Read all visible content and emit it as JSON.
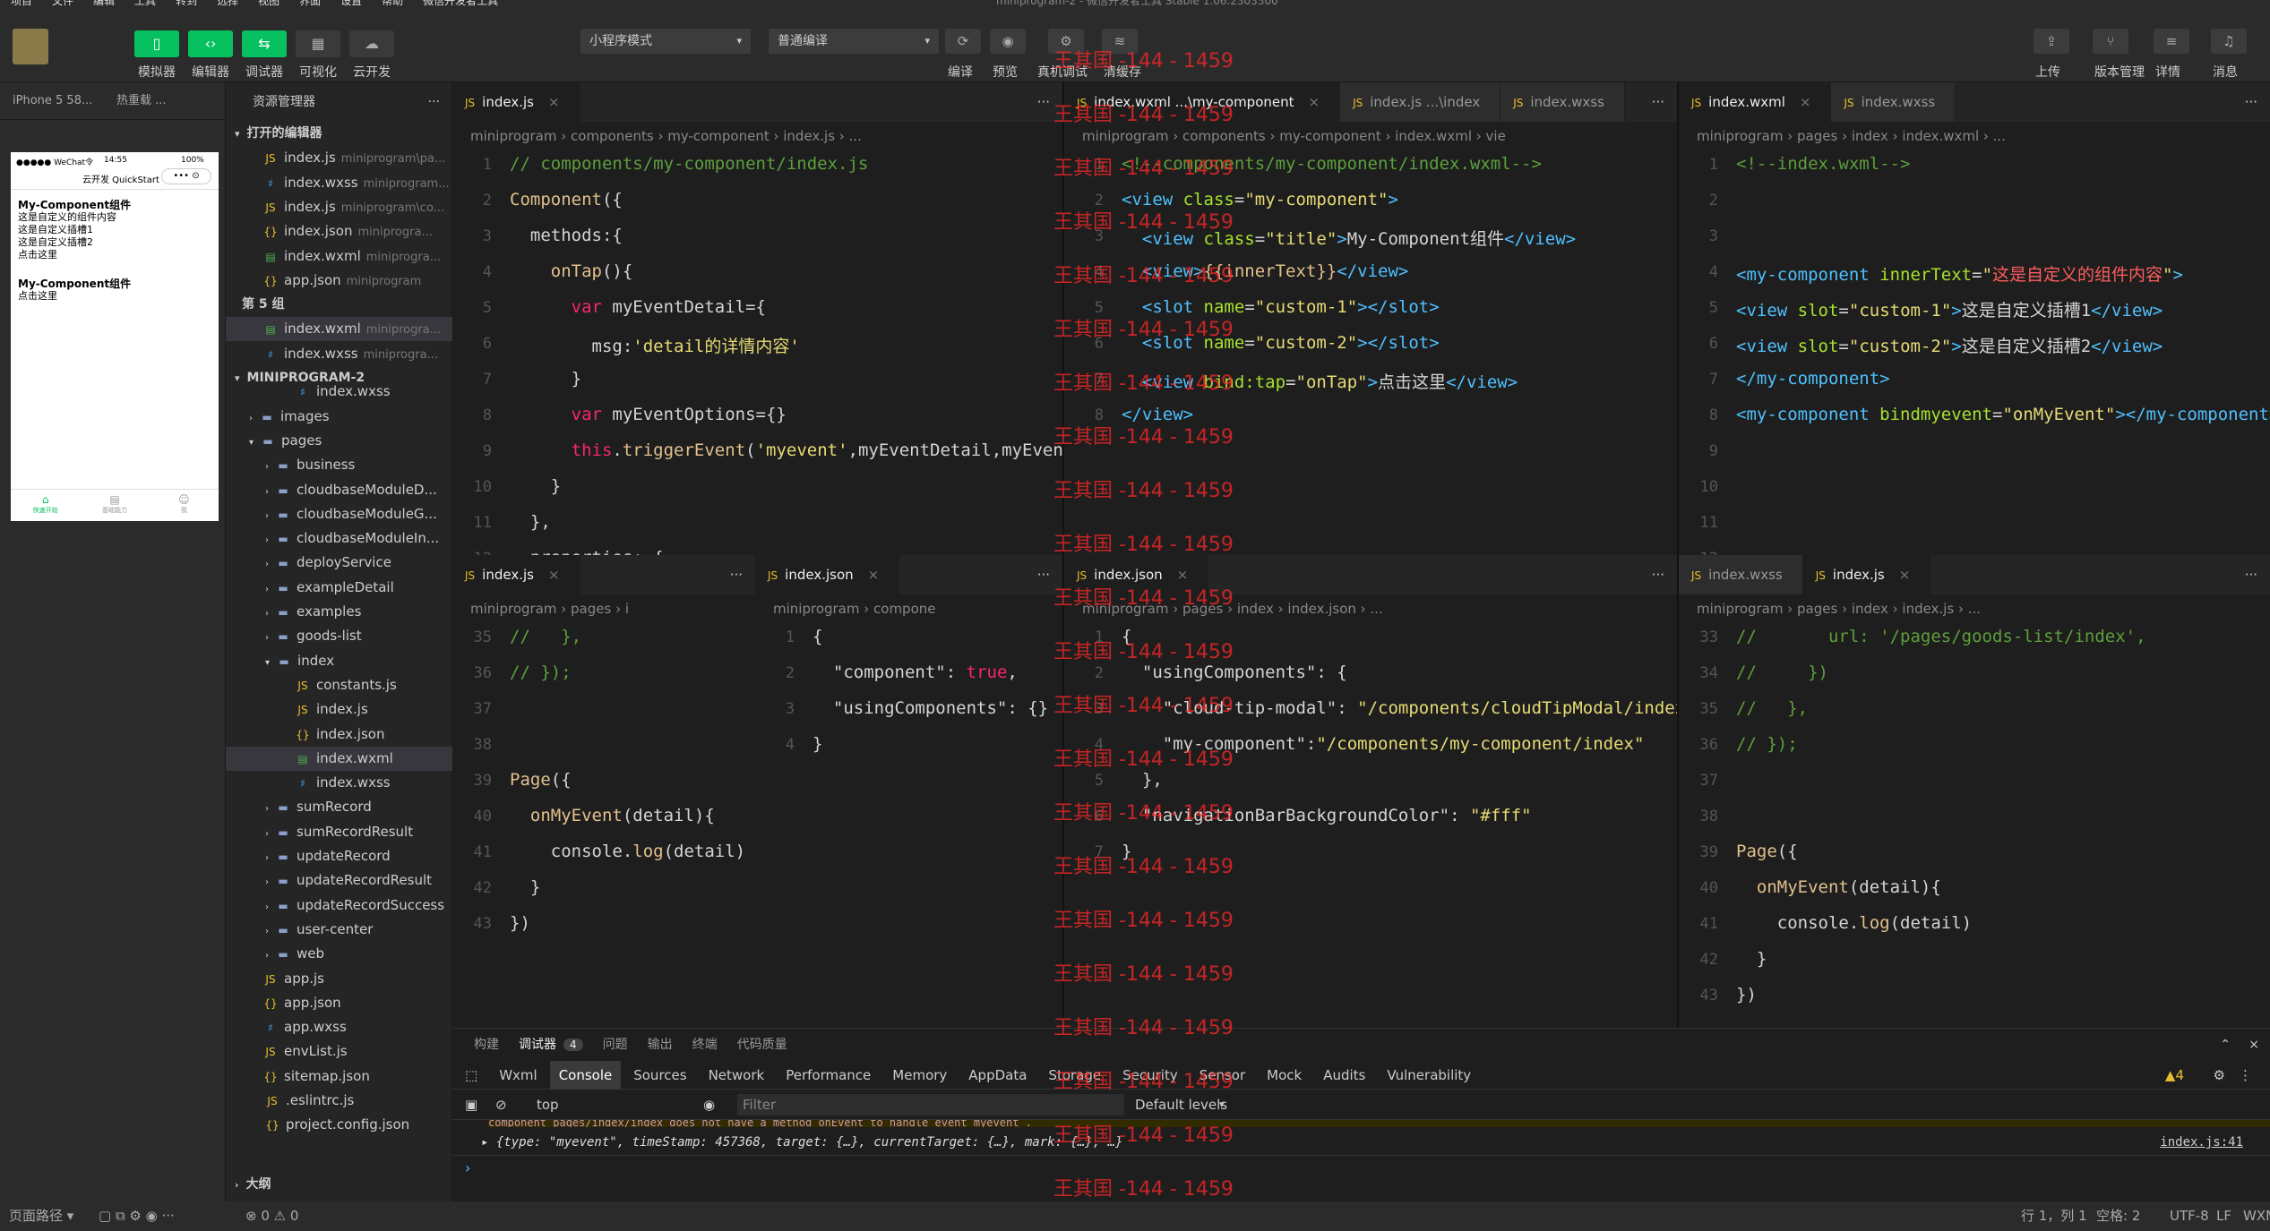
{
  "menubar": {
    "items": [
      "项目",
      "文件",
      "编辑",
      "工具",
      "转到",
      "选择",
      "视图",
      "界面",
      "设置",
      "帮助",
      "微信开发者工具"
    ],
    "window_title": "miniprogram-2 - 微信开发者工具 Stable 1.06.2303300"
  },
  "toolbar": {
    "buttons": [
      {
        "label": "模拟器",
        "icon": "phone-icon"
      },
      {
        "label": "编辑器",
        "icon": "code-icon"
      },
      {
        "label": "调试器",
        "icon": "debug-icon"
      },
      {
        "label": "可视化",
        "icon": "layout-icon"
      },
      {
        "label": "云开发",
        "icon": "cloud-icon"
      }
    ],
    "mode_select": "小程序模式",
    "compile_select": "普通编译",
    "actions": [
      "编译",
      "预览",
      "真机调试",
      "清缓存"
    ],
    "right": [
      "上传",
      "版本管理",
      "详情",
      "消息"
    ]
  },
  "simulator": {
    "device": "iPhone 5 58...",
    "reload": "热重载 ...",
    "wechat_status": "●●●●● WeChat令",
    "time": "14:55",
    "battery": "100%",
    "nav_title": "云开发 QuickStart",
    "lines": [
      "My-Component组件",
      "这是自定义的组件内容",
      "这是自定义插槽1",
      "这是自定义插槽2",
      "点击这里",
      "",
      "My-Component组件",
      "点击这里"
    ],
    "tabbar": [
      "快速开始",
      "基础能力",
      "我"
    ]
  },
  "explorer": {
    "title": "资源管理器",
    "open_editors": "打开的编辑器",
    "group5": "第 5 组",
    "project": "MINIPROGRAM-2",
    "outline": "大纲",
    "open": [
      {
        "name": "index.js",
        "sub": "miniprogram\\pa...",
        "t": "js"
      },
      {
        "name": "index.wxss",
        "sub": "miniprogram...",
        "t": "wxss"
      },
      {
        "name": "index.js",
        "sub": "miniprogram\\co...",
        "t": "js"
      },
      {
        "name": "index.json",
        "sub": "miniprogra...",
        "t": "json"
      },
      {
        "name": "index.wxml",
        "sub": "miniprogra...",
        "t": "wx"
      },
      {
        "name": "app.json",
        "sub": "miniprogram",
        "t": "json"
      }
    ],
    "group5_files": [
      {
        "name": "index.wxml",
        "sub": "miniprogra...",
        "t": "wx"
      },
      {
        "name": "index.wxss",
        "sub": "miniprogra...",
        "t": "wxss"
      }
    ],
    "tree": [
      {
        "name": "index.wxss",
        "t": "wxss",
        "d": 3
      },
      {
        "name": "images",
        "t": "folder",
        "d": 1
      },
      {
        "name": "pages",
        "t": "folder",
        "d": 1,
        "open": true
      },
      {
        "name": "business",
        "t": "folder",
        "d": 2
      },
      {
        "name": "cloudbaseModuleD...",
        "t": "folder",
        "d": 2
      },
      {
        "name": "cloudbaseModuleG...",
        "t": "folder",
        "d": 2
      },
      {
        "name": "cloudbaseModuleIn...",
        "t": "folder",
        "d": 2
      },
      {
        "name": "deployService",
        "t": "folder",
        "d": 2
      },
      {
        "name": "exampleDetail",
        "t": "folder",
        "d": 2
      },
      {
        "name": "examples",
        "t": "folder",
        "d": 2
      },
      {
        "name": "goods-list",
        "t": "folder",
        "d": 2
      },
      {
        "name": "index",
        "t": "folder",
        "d": 2,
        "open": true
      },
      {
        "name": "constants.js",
        "t": "js",
        "d": 3
      },
      {
        "name": "index.js",
        "t": "js",
        "d": 3
      },
      {
        "name": "index.json",
        "t": "json",
        "d": 3
      },
      {
        "name": "index.wxml",
        "t": "wx",
        "d": 3,
        "sel": true
      },
      {
        "name": "index.wxss",
        "t": "wxss",
        "d": 3
      },
      {
        "name": "sumRecord",
        "t": "folder",
        "d": 2
      },
      {
        "name": "sumRecordResult",
        "t": "folder",
        "d": 2
      },
      {
        "name": "updateRecord",
        "t": "folder",
        "d": 2
      },
      {
        "name": "updateRecordResult",
        "t": "folder",
        "d": 2
      },
      {
        "name": "updateRecordSuccess",
        "t": "folder",
        "d": 2
      },
      {
        "name": "user-center",
        "t": "folder",
        "d": 2
      },
      {
        "name": "web",
        "t": "folder",
        "d": 2
      },
      {
        "name": "app.js",
        "t": "js",
        "d": 1
      },
      {
        "name": "app.json",
        "t": "json",
        "d": 1
      },
      {
        "name": "app.wxss",
        "t": "wxss",
        "d": 1
      },
      {
        "name": "envList.js",
        "t": "js",
        "d": 1
      },
      {
        "name": "sitemap.json",
        "t": "json",
        "d": 1
      },
      {
        "name": ".eslintrc.js",
        "t": "js",
        "d": 0
      },
      {
        "name": "project.config.json",
        "t": "json",
        "d": 0
      }
    ]
  },
  "panes": {
    "p1": {
      "tabs": [
        "index.js"
      ],
      "crumb": "miniprogram › components › my-component › index.js › ..."
    },
    "p2": {
      "tabs": [
        "index.wxml ...\\my-component",
        "index.js ...\\index",
        "index.wxss"
      ],
      "crumb": "miniprogram › components › my-component › index.wxml › vie"
    },
    "p3": {
      "tabs": [
        "index.wxml",
        "index.wxss"
      ],
      "crumb": "miniprogram › pages › index › index.wxml › ..."
    },
    "p4": {
      "tabs": [
        "index.js"
      ],
      "crumb": "miniprogram › pages › i"
    },
    "p5": {
      "tabs": [
        "index.json"
      ],
      "crumb": "miniprogram › compone"
    },
    "p6": {
      "tabs": [
        "index.json"
      ],
      "crumb": "miniprogram › pages › index › index.json › ..."
    },
    "p7": {
      "tabs": [
        "index.wxss",
        "index.js"
      ],
      "crumb": "miniprogram › pages › index › index.js › ..."
    }
  },
  "watermark": "王其国 -144 - 1459",
  "debug": {
    "top_tabs": [
      "构建",
      "调试器",
      "问题",
      "输出",
      "终端",
      "代码质量"
    ],
    "debug_badge": "4",
    "dev_tabs": [
      "Wxml",
      "Console",
      "Sources",
      "Network",
      "Performance",
      "Memory",
      "AppData",
      "Storage",
      "Security",
      "Sensor",
      "Mock",
      "Audits",
      "Vulnerability"
    ],
    "warn_count": "▲4",
    "context": "top",
    "filter": "Filter",
    "levels": "Default levels",
    "log": "▸ {type: \"myevent\", timeStamp: 457368, target: {…}, currentTarget: {…}, mark: {…}, …}",
    "log_src": "index.js:41",
    "truncated": "component  pages/index/index  does not have a method  onEvent  to handle event  myevent ."
  },
  "status": {
    "left": "页面路径 ▾",
    "errors": "⊗ 0 ⚠ 0",
    "pos": "行 1，列 1",
    "spaces": "空格: 2",
    "enc": "UTF-8",
    "eol": "LF",
    "lang": "WXML"
  }
}
